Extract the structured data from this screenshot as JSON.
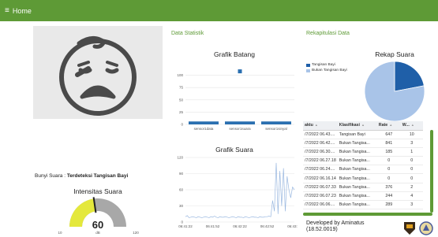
{
  "header": {
    "menu_icon": "≡",
    "title": "Home"
  },
  "left": {
    "bunyi_label": "Bunyi Suara :",
    "bunyi_value": "Terdeteksi Tangisan Bayi",
    "intensitas_title": "Intensitas Suara",
    "gauge": {
      "value": "60",
      "value_num": 60,
      "min": "10",
      "max": "120",
      "unit": "dB",
      "min_num": 10,
      "max_num": 120
    }
  },
  "statistik": {
    "section_title": "Data Statistik",
    "bar_chart_title": "Grafik Batang",
    "line_chart_title": "Grafik Suara"
  },
  "rekap": {
    "section_title": "Rekapitulasi Data",
    "pie_title": "Rekap Suara",
    "legend": [
      "Tangisan Bayi",
      "Bukan Tangisan Bayi"
    ],
    "table_headers": [
      "aktu",
      "Klasifikasi",
      "Rate",
      "W..."
    ],
    "rows": [
      [
        "/7/2022 06.43....",
        "Tangisan Bayi",
        "647",
        "10"
      ],
      [
        "/7/2022 06.42....",
        "Bukan Tangisa...",
        "841",
        "3"
      ],
      [
        "/7/2022 06.30....",
        "Bukan Tangisa...",
        "185",
        "1"
      ],
      [
        "/7/2022 06.27.18",
        "Bukan Tangisa...",
        "0",
        "0"
      ],
      [
        "/7/2022 06.24....",
        "Bukan Tangisa...",
        "0",
        "0"
      ],
      [
        "/7/2022 06.16.14",
        "Bukan Tangisa...",
        "0",
        "0"
      ],
      [
        "/7/2022 06.07.33",
        "Bukan Tangisa...",
        "376",
        "2"
      ],
      [
        "/7/2022 06.07.23",
        "Bukan Tangisa...",
        "244",
        "4"
      ],
      [
        "/7/2022 06.06....",
        "Bukan Tangisa...",
        "289",
        "3"
      ]
    ],
    "credit_line1": "Developed by Aminatus",
    "credit_line2": "(18.52.0019)"
  },
  "colors": {
    "brand_green": "#5e9a36",
    "bar_blue": "#2a6fb0",
    "pie_dark": "#1f5fa8",
    "pie_light": "#a9c4e8",
    "gauge_yellow": "#e4e83c",
    "gauge_gray": "#a8a8a8"
  },
  "chart_data": [
    {
      "type": "bar",
      "title": "Grafik Batang",
      "categories": [
        "sensor1data",
        "sensor1suara",
        "sensor1sinyal"
      ],
      "values": [
        6,
        6,
        6
      ],
      "extra_point": {
        "category": "sensor1suara",
        "value": 108
      },
      "ylim": [
        0,
        125
      ],
      "yticks": [
        0,
        25,
        50,
        75,
        100
      ]
    },
    {
      "type": "line",
      "title": "Grafik Suara",
      "xticks": [
        "06:41:22",
        "06:41:52",
        "06:42:22",
        "06:42:52",
        "06:43:23"
      ],
      "yticks": [
        0,
        30,
        60,
        90,
        120
      ],
      "ylim": [
        0,
        120
      ],
      "x": [
        0,
        2,
        4,
        6,
        8,
        10,
        12,
        14,
        16,
        18,
        20,
        22,
        24,
        26,
        28,
        30,
        32,
        34,
        36,
        38,
        40,
        42,
        44,
        46,
        48,
        50,
        52,
        54,
        56,
        58,
        60,
        62,
        64,
        66,
        68,
        70,
        72,
        74,
        76,
        78,
        80,
        82,
        84,
        86,
        88,
        90,
        92,
        94,
        96,
        98,
        100,
        102,
        104,
        106,
        108,
        110,
        112,
        114,
        116,
        118,
        120
      ],
      "y": [
        10,
        12,
        8,
        9,
        10,
        9,
        8,
        10,
        9,
        8,
        9,
        10,
        9,
        8,
        10,
        9,
        11,
        9,
        8,
        10,
        9,
        9,
        10,
        9,
        8,
        9,
        10,
        9,
        8,
        10,
        9,
        9,
        8,
        10,
        9,
        8,
        9,
        10,
        9,
        9,
        8,
        10,
        9,
        9,
        10,
        10,
        11,
        10,
        40,
        20,
        110,
        15,
        95,
        30,
        100,
        20,
        85,
        60,
        45,
        65,
        60
      ]
    },
    {
      "type": "pie",
      "title": "Rekap Suara",
      "labels": [
        "Tangisan Bayi",
        "Bukan Tangisan Bayi"
      ],
      "values": [
        22,
        78
      ]
    }
  ]
}
